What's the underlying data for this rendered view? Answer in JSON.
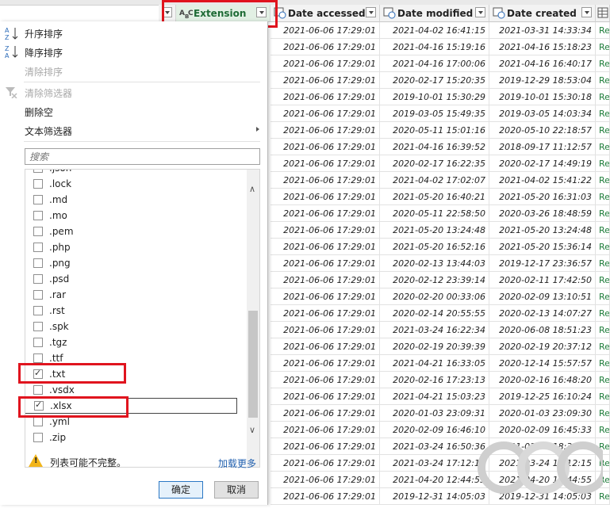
{
  "headers": {
    "extension": "Extension",
    "date_accessed": "Date accessed",
    "date_modified": "Date modified",
    "date_created": "Date created"
  },
  "rows": [
    {
      "accessed": "2021-06-06 17:29:01",
      "modified": "2021-04-02 16:41:15",
      "created": "2021-03-31 14:33:34",
      "extra": "Rec"
    },
    {
      "accessed": "2021-06-06 17:29:01",
      "modified": "2021-04-16 15:19:16",
      "created": "2021-04-16 15:18:23",
      "extra": "Rec"
    },
    {
      "accessed": "2021-06-06 17:29:01",
      "modified": "2021-04-16 17:00:06",
      "created": "2021-04-16 16:40:17",
      "extra": "Rec"
    },
    {
      "accessed": "2021-06-06 17:29:01",
      "modified": "2020-02-17 15:20:35",
      "created": "2019-12-29 18:53:04",
      "extra": "Rec"
    },
    {
      "accessed": "2021-06-06 17:29:01",
      "modified": "2019-10-01 15:30:29",
      "created": "2019-10-01 15:30:18",
      "extra": "Rec"
    },
    {
      "accessed": "2021-06-06 17:29:01",
      "modified": "2019-03-05 15:49:35",
      "created": "2019-03-05 14:03:34",
      "extra": "Rec"
    },
    {
      "accessed": "2021-06-06 17:29:01",
      "modified": "2020-05-11 15:01:16",
      "created": "2020-05-10 22:18:57",
      "extra": "Rec"
    },
    {
      "accessed": "2021-06-06 17:29:01",
      "modified": "2021-04-16 16:39:52",
      "created": "2018-09-17 11:12:57",
      "extra": "Rec"
    },
    {
      "accessed": "2021-06-06 17:29:01",
      "modified": "2020-02-17 16:22:35",
      "created": "2020-02-17 14:49:19",
      "extra": "Rec"
    },
    {
      "accessed": "2021-06-06 17:29:01",
      "modified": "2021-04-02 17:02:07",
      "created": "2021-04-02 15:41:22",
      "extra": "Rec"
    },
    {
      "accessed": "2021-06-06 17:29:01",
      "modified": "2021-05-20 16:40:21",
      "created": "2021-05-20 16:31:03",
      "extra": "Rec"
    },
    {
      "accessed": "2021-06-06 17:29:01",
      "modified": "2020-05-11 22:58:50",
      "created": "2020-03-26 18:48:59",
      "extra": "Rec"
    },
    {
      "accessed": "2021-06-06 17:29:01",
      "modified": "2021-05-20 13:24:48",
      "created": "2021-05-20 13:24:48",
      "extra": "Rec"
    },
    {
      "accessed": "2021-06-06 17:29:01",
      "modified": "2021-05-20 16:52:16",
      "created": "2021-05-20 15:36:14",
      "extra": "Rec"
    },
    {
      "accessed": "2021-06-06 17:29:01",
      "modified": "2020-02-13 13:44:03",
      "created": "2019-12-17 23:36:57",
      "extra": "Rec"
    },
    {
      "accessed": "2021-06-06 17:29:01",
      "modified": "2020-02-12 23:39:14",
      "created": "2020-02-11 17:42:50",
      "extra": "Rec"
    },
    {
      "accessed": "2021-06-06 17:29:01",
      "modified": "2020-02-20 00:33:06",
      "created": "2020-02-09 13:10:51",
      "extra": "Rec"
    },
    {
      "accessed": "2021-06-06 17:29:01",
      "modified": "2020-02-14 20:55:55",
      "created": "2020-02-13 14:07:27",
      "extra": "Rec"
    },
    {
      "accessed": "2021-06-06 17:29:01",
      "modified": "2021-03-24 16:22:34",
      "created": "2020-06-08 18:51:23",
      "extra": "Rec"
    },
    {
      "accessed": "2021-06-06 17:29:01",
      "modified": "2020-02-19 20:39:39",
      "created": "2020-02-19 20:37:12",
      "extra": "Rec"
    },
    {
      "accessed": "2021-06-06 17:29:01",
      "modified": "2021-04-21 16:33:05",
      "created": "2020-12-14 15:57:57",
      "extra": "Rec"
    },
    {
      "accessed": "2021-06-06 17:29:01",
      "modified": "2020-02-16 17:23:13",
      "created": "2020-02-16 16:48:20",
      "extra": "Rec"
    },
    {
      "accessed": "2021-06-06 17:29:01",
      "modified": "2021-04-21 15:03:23",
      "created": "2019-12-25 16:10:24",
      "extra": "Rec"
    },
    {
      "accessed": "2021-06-06 17:29:01",
      "modified": "2020-01-03 23:09:31",
      "created": "2020-01-03 23:09:30",
      "extra": "Rec"
    },
    {
      "accessed": "2021-06-06 17:29:01",
      "modified": "2020-02-09 16:46:10",
      "created": "2020-02-09 16:45:33",
      "extra": "Rec"
    },
    {
      "accessed": "2021-06-06 17:29:01",
      "modified": "2021-03-24 16:50:36",
      "created": "2021-03-21 18:38:57",
      "extra": "Rec"
    },
    {
      "accessed": "2021-06-06 17:29:01",
      "modified": "2021-03-24 17:12:15",
      "created": "2021-03-24 17:12:15",
      "extra": "Rec"
    },
    {
      "accessed": "2021-06-06 17:29:01",
      "modified": "2021-04-20 12:44:55",
      "created": "2021-04-20 12:44:55",
      "extra": "Rec"
    },
    {
      "accessed": "2021-06-06 17:29:01",
      "modified": "2019-12-31 14:05:03",
      "created": "2019-12-31 14:05:03",
      "extra": "Rec"
    }
  ],
  "menu": {
    "sort_asc": "升序排序",
    "sort_desc": "降序排序",
    "clear_sort": "清除排序",
    "clear_filter": "清除筛选器",
    "remove_empty": "删除空",
    "text_filters": "文本筛选器"
  },
  "search": {
    "placeholder": "搜索"
  },
  "filter_items": [
    {
      "label": ".json",
      "checked": false
    },
    {
      "label": ".lock",
      "checked": false
    },
    {
      "label": ".md",
      "checked": false
    },
    {
      "label": ".mo",
      "checked": false
    },
    {
      "label": ".pem",
      "checked": false
    },
    {
      "label": ".php",
      "checked": false
    },
    {
      "label": ".png",
      "checked": false
    },
    {
      "label": ".psd",
      "checked": false
    },
    {
      "label": ".rar",
      "checked": false
    },
    {
      "label": ".rst",
      "checked": false
    },
    {
      "label": ".spk",
      "checked": false
    },
    {
      "label": ".tgz",
      "checked": false
    },
    {
      "label": ".ttf",
      "checked": false
    },
    {
      "label": ".txt",
      "checked": true
    },
    {
      "label": ".vsdx",
      "checked": false
    },
    {
      "label": ".xlsx",
      "checked": true
    },
    {
      "label": ".yml",
      "checked": false
    },
    {
      "label": ".zip",
      "checked": false
    }
  ],
  "warning": {
    "text": "列表可能不完整。",
    "load_more": "加载更多"
  },
  "buttons": {
    "ok": "确定",
    "cancel": "取消"
  },
  "colors": {
    "highlight": "#e0141e",
    "accent_green": "#1e7d3a"
  }
}
